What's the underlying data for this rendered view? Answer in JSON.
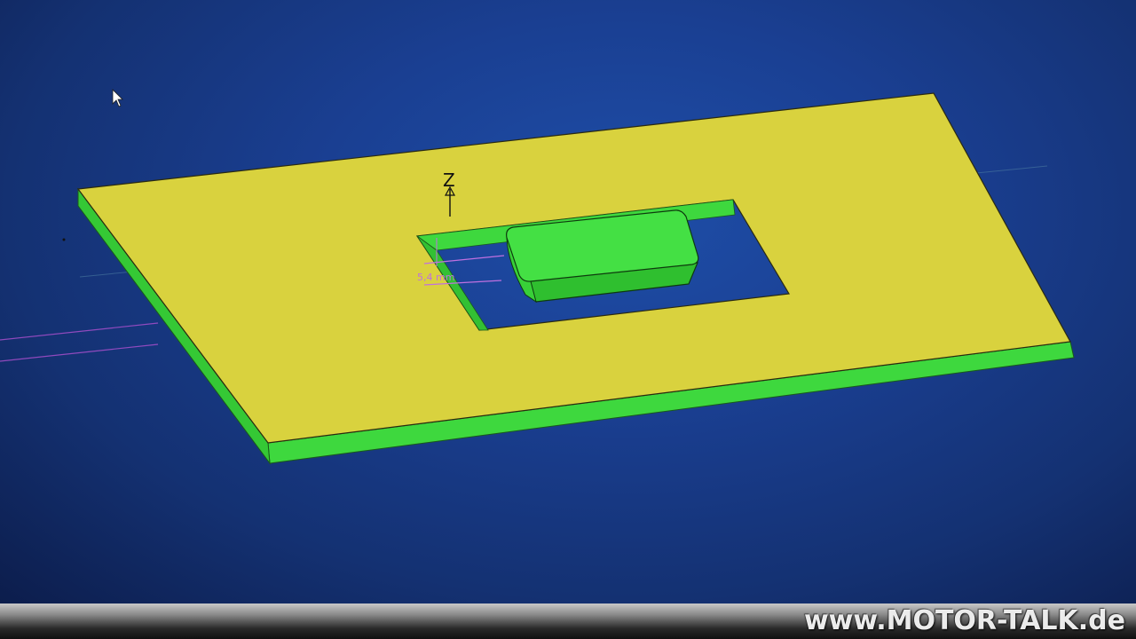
{
  "viewport": {
    "background_color": "#1a3f92",
    "plate_top_color": "#d9d23e",
    "plate_edge_color": "#3ed83e",
    "block_color": "#44e044",
    "dimension_color": "#c070e0"
  },
  "axis": {
    "label": "Z"
  },
  "dimension": {
    "label": "5,4 mm"
  },
  "cursor": {
    "icon": "arrow-cursor-icon"
  },
  "watermark": {
    "text": "www.MOTOR-TALK.de"
  }
}
